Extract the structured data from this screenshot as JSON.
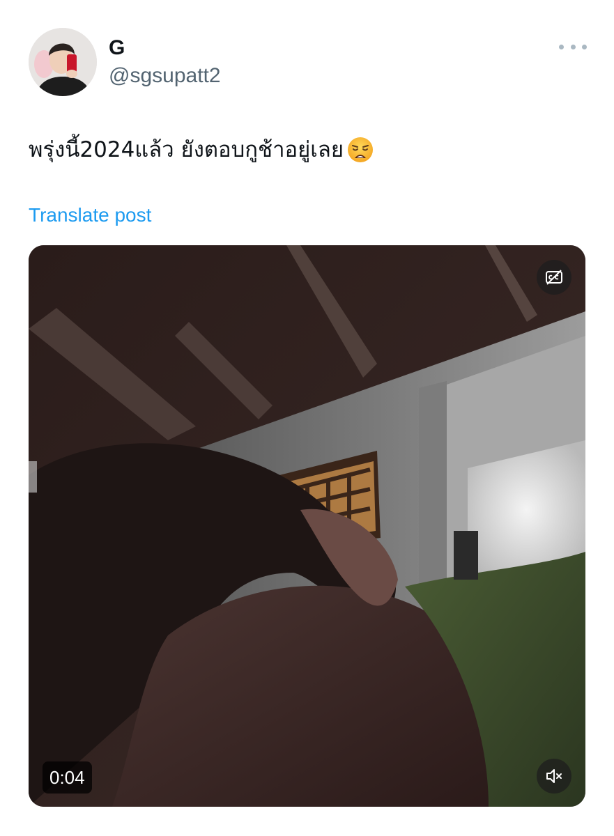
{
  "author": {
    "display_name": "G",
    "handle": "@sgsupatt2",
    "avatar_icon": "profile-photo"
  },
  "header": {
    "more_icon": "more-dots-icon"
  },
  "post": {
    "text": "พรุ่งนี้2024แล้ว ยังตอบกูช้าอยู่เลย",
    "emoji": "weary-face-emoji",
    "translate_label": "Translate post"
  },
  "media": {
    "type": "video",
    "duration": "0:04",
    "captions_icon": "captions-off-icon",
    "mute_icon": "muted-speaker-icon"
  },
  "colors": {
    "link": "#1d9bf0",
    "secondary_text": "#536471",
    "primary_text": "#0f1419"
  }
}
